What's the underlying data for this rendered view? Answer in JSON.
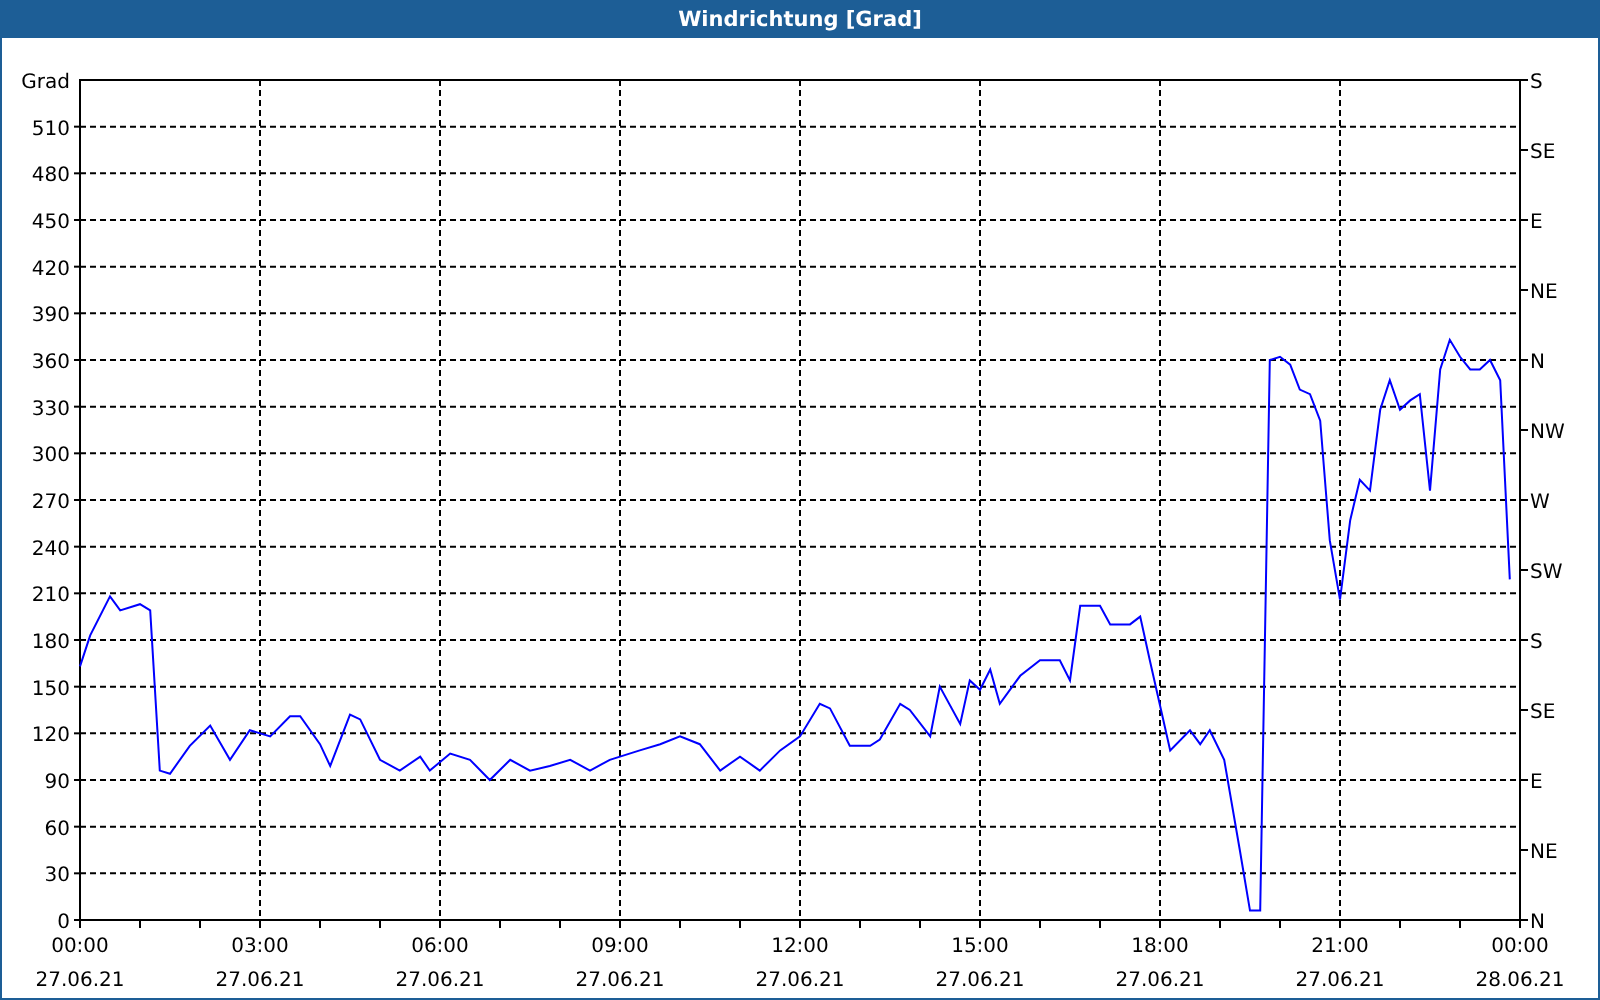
{
  "window": {
    "title": "Windrichtung [Grad]"
  },
  "chart": {
    "chart_data": {
      "type": "line",
      "ylabel": "Grad",
      "xlim": [
        0,
        24
      ],
      "ylim": [
        0,
        540
      ],
      "x": [
        0,
        0.17,
        0.5,
        0.67,
        1,
        1.17,
        1.33,
        1.5,
        1.83,
        2.17,
        2.5,
        2.83,
        3.17,
        3.5,
        3.67,
        4,
        4.17,
        4.5,
        4.67,
        5,
        5.33,
        5.67,
        5.83,
        6.17,
        6.5,
        6.83,
        7.17,
        7.5,
        7.83,
        8.17,
        8.5,
        8.83,
        9,
        9.33,
        9.67,
        10,
        10.33,
        10.67,
        11,
        11.33,
        11.67,
        12,
        12.33,
        12.5,
        12.83,
        13.17,
        13.33,
        13.67,
        13.83,
        14.17,
        14.33,
        14.67,
        14.83,
        15,
        15.17,
        15.33,
        15.67,
        16,
        16.33,
        16.5,
        16.67,
        17,
        17.17,
        17.5,
        17.67,
        17.83,
        18.17,
        18.5,
        18.67,
        18.83,
        19.07,
        19.33,
        19.5,
        19.67,
        19.83,
        20,
        20.17,
        20.33,
        20.5,
        20.67,
        20.83,
        21,
        21.17,
        21.33,
        21.5,
        21.67,
        21.83,
        22,
        22.17,
        22.33,
        22.5,
        22.67,
        22.83,
        23,
        23.17,
        23.33,
        23.5,
        23.67,
        23.83
      ],
      "grid": true,
      "series": [
        {
          "color": "#0000ff",
          "values": [
            163,
            183,
            208,
            199,
            203,
            199,
            96,
            94,
            112,
            125,
            103,
            122,
            118,
            131,
            131,
            113,
            99,
            132,
            129,
            103,
            96,
            105,
            96,
            107,
            103,
            90,
            103,
            96,
            99,
            103,
            96,
            103,
            105,
            109,
            113,
            118,
            113,
            96,
            105,
            96,
            109,
            118,
            139,
            136,
            112,
            112,
            116,
            139,
            135,
            118,
            150,
            126,
            154,
            148,
            161,
            139,
            157,
            167,
            167,
            154,
            202,
            202,
            190,
            190,
            195,
            167,
            109,
            122,
            113,
            122,
            103,
            45,
            6,
            6,
            360,
            362,
            357,
            341,
            338,
            321,
            244,
            206,
            257,
            283,
            276,
            328,
            347,
            328,
            334,
            338,
            276,
            354,
            373,
            362,
            354,
            354,
            360,
            347,
            219
          ]
        }
      ],
      "xticks": [
        {
          "value": 0,
          "label": "00:00"
        },
        {
          "value": 3,
          "label": "03:00"
        },
        {
          "value": 6,
          "label": "06:00"
        },
        {
          "value": 9,
          "label": "09:00"
        },
        {
          "value": 12,
          "label": "12:00"
        },
        {
          "value": 15,
          "label": "15:00"
        },
        {
          "value": 18,
          "label": "18:00"
        },
        {
          "value": 21,
          "label": "21:00"
        },
        {
          "value": 24,
          "label": "00:00"
        }
      ],
      "yticks": [
        0,
        30,
        60,
        90,
        120,
        150,
        180,
        210,
        240,
        270,
        300,
        330,
        360,
        390,
        420,
        450,
        480,
        510
      ]
    },
    "x_tick_dates": [
      "27.06.21",
      "27.06.21",
      "27.06.21",
      "27.06.21",
      "27.06.21",
      "27.06.21",
      "27.06.21",
      "27.06.21",
      "28.06.21"
    ],
    "right_axis_ticks": [
      "S",
      "SE",
      "E",
      "NE",
      "N",
      "NW",
      "W",
      "SW",
      "S",
      "SE",
      "E",
      "NE",
      "N"
    ]
  }
}
